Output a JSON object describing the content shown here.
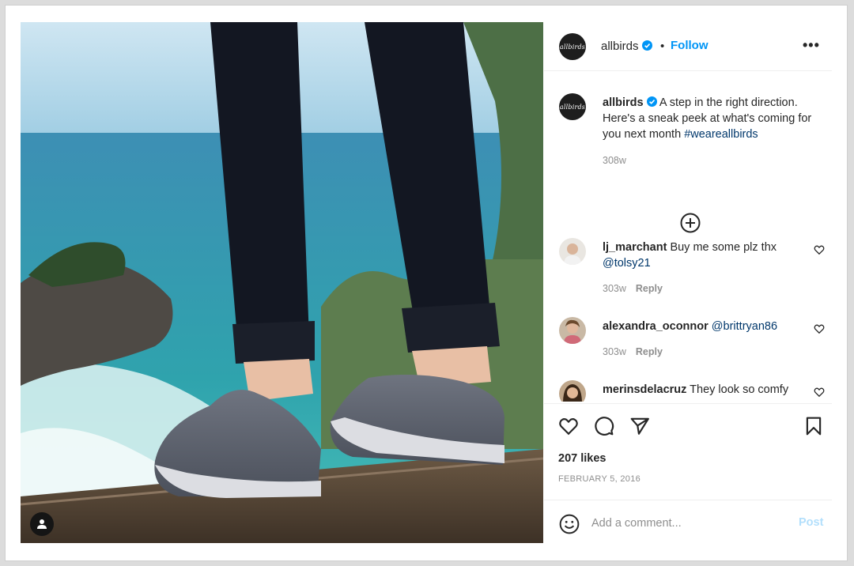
{
  "post": {
    "username": "allbirds",
    "avatar_text": "allbirds",
    "follow_label": "Follow",
    "separator": "•",
    "more_label": "•••",
    "caption": {
      "username": "allbirds",
      "text": "A step in the right direction. Here's a sneak peek at what's coming for you next month",
      "hashtag": "#weareallbirds",
      "time": "308w"
    },
    "comments": [
      {
        "username": "lj_marchant",
        "text": "Buy me some plz thx",
        "mention": "@tolsy21",
        "time": "303w",
        "reply_label": "Reply"
      },
      {
        "username": "alexandra_oconnor",
        "text": "",
        "mention": "@brittryan86",
        "time": "303w",
        "reply_label": "Reply"
      },
      {
        "username": "merinsdelacruz",
        "text": "They look so comfy",
        "mention": "",
        "time": "",
        "reply_label": ""
      }
    ],
    "likes": "207 likes",
    "date": "FEBRUARY 5, 2016",
    "comment_placeholder": "Add a comment...",
    "post_label": "Post"
  },
  "icons": {
    "verified": "verified-badge-icon",
    "more_comments": "plus-circle-icon",
    "like": "heart-icon",
    "comment": "speech-bubble-icon",
    "share": "paper-plane-icon",
    "save": "bookmark-icon",
    "emoji": "smiley-icon",
    "tagged_user": "user-icon"
  },
  "colors": {
    "accent": "#0095f6",
    "link": "#00376b",
    "muted": "#8e8e8e",
    "post_disabled": "#b2dffc"
  }
}
